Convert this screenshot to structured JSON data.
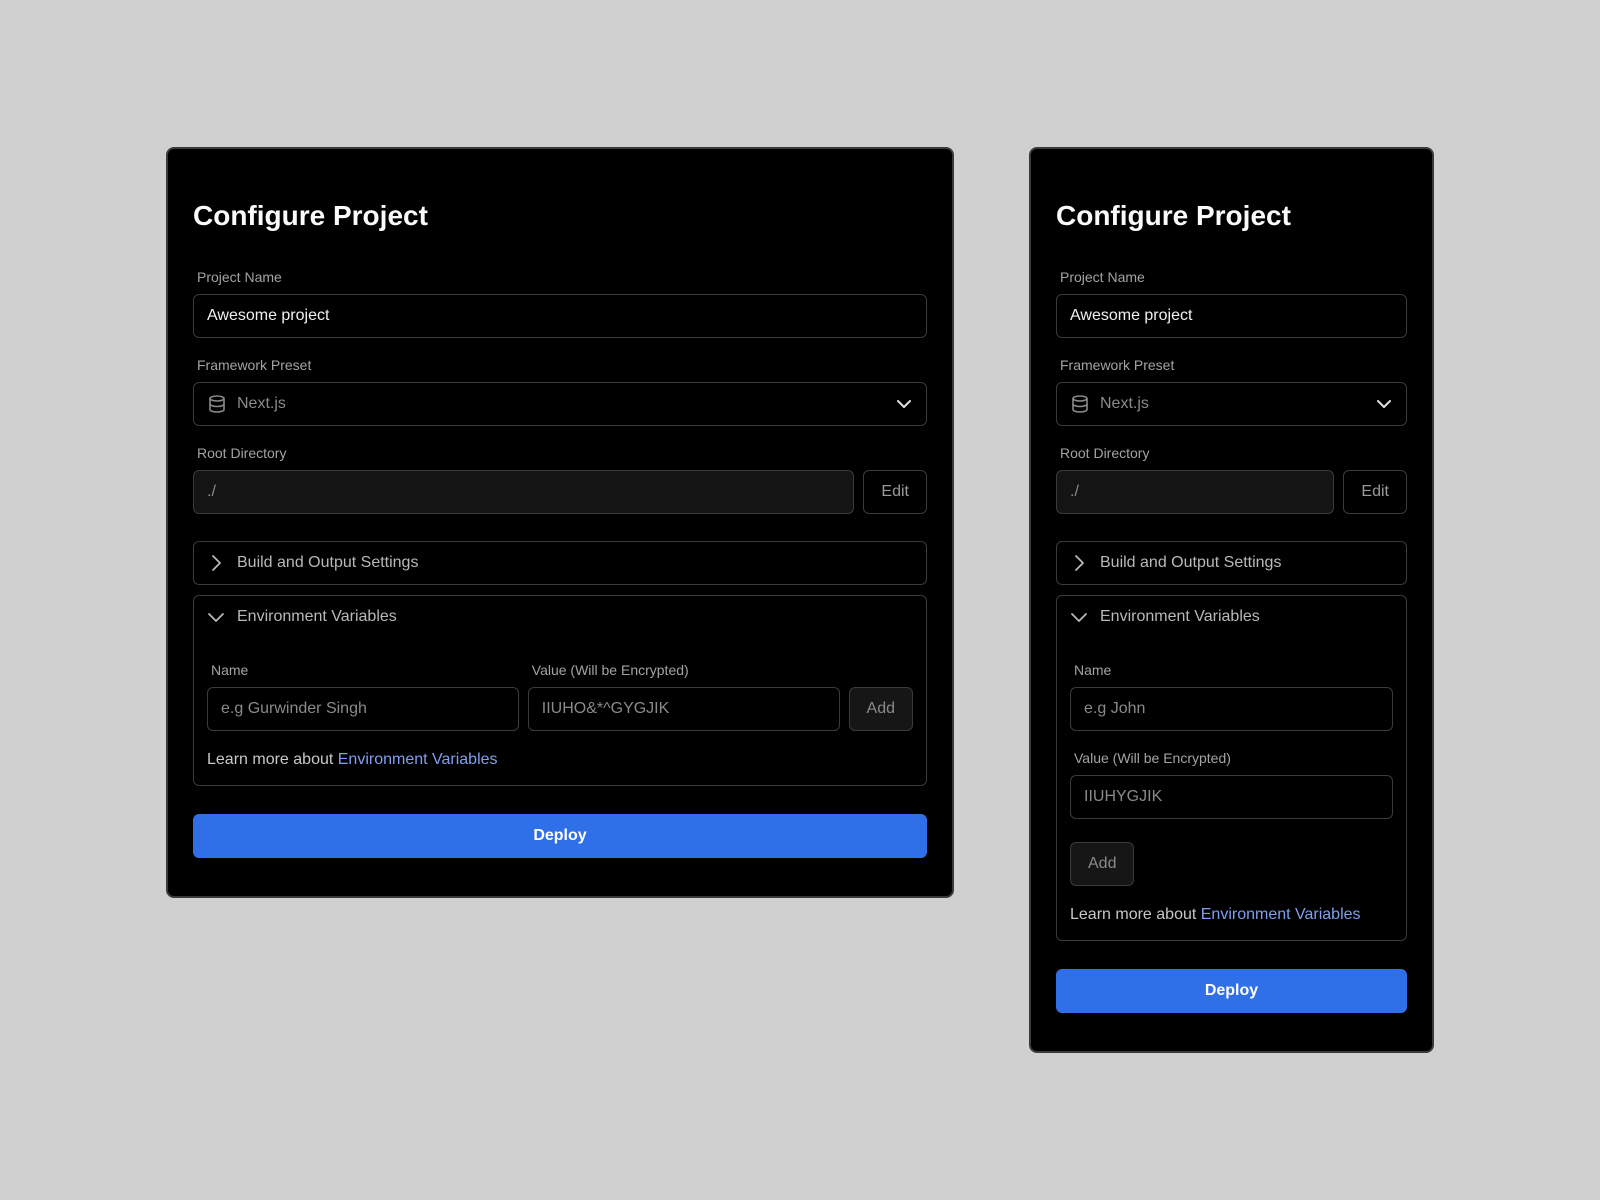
{
  "wide": {
    "title": "Configure Project",
    "project_name_label": "Project Name",
    "project_name_value": "Awesome project",
    "framework_label": "Framework Preset",
    "framework_value": "Next.js",
    "root_dir_label": "Root Directory",
    "root_dir_value": "./",
    "edit_label": "Edit",
    "build_section_label": "Build and Output Settings",
    "env_section_label": "Environment Variables",
    "env_name_label": "Name",
    "env_name_placeholder": "e.g Gurwinder Singh",
    "env_value_label": "Value (Will be Encrypted)",
    "env_value_placeholder": "IIUHO&*^GYGJIK",
    "add_label": "Add",
    "learn_prefix": "Learn more about ",
    "learn_link": "Environment Variables",
    "deploy_label": "Deploy"
  },
  "narrow": {
    "title": "Configure Project",
    "project_name_label": "Project Name",
    "project_name_value": "Awesome project",
    "framework_label": "Framework Preset",
    "framework_value": "Next.js",
    "root_dir_label": "Root Directory",
    "root_dir_value": "./",
    "edit_label": "Edit",
    "build_section_label": "Build and Output Settings",
    "env_section_label": "Environment Variables",
    "env_name_label": "Name",
    "env_name_placeholder": "e.g John",
    "env_value_label": "Value (Will be Encrypted)",
    "env_value_placeholder": "IIUHYGJIK",
    "add_label": "Add",
    "learn_prefix": "Learn more about ",
    "learn_link": "Environment Variables",
    "deploy_label": "Deploy"
  },
  "colors": {
    "background": "#d0d0d0",
    "card": "#000000",
    "accent": "#2f6fe8",
    "link": "#7f9ff0"
  },
  "icons": {
    "framework": "database-icon",
    "dropdown": "chevron-down-icon",
    "collapsed": "chevron-right-icon",
    "expanded": "chevron-down-icon"
  }
}
